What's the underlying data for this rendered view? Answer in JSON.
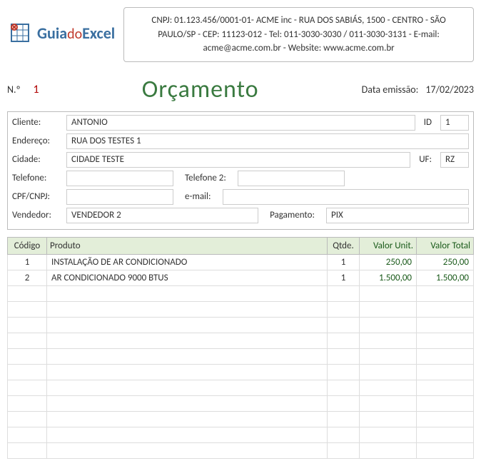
{
  "company_info": "CNPJ: 01.123.456/0001-01- ACME inc - RUA DOS SABIÁS, 1500 - CENTRO - SÃO PAULO/SP - CEP: 11123-012 - Tel: 011-3030-3030 / 011-3030-3131 - E-mail: acme@acme.com.br - Website: www.acme.com.br",
  "logo": {
    "guia": "Guia",
    "do": "do",
    "excel": "Excel"
  },
  "title": {
    "no_label": "N.º",
    "no_value": "1",
    "main": "Orçamento",
    "date_label": "Data emissão:",
    "date_value": "17/02/2023"
  },
  "customer": {
    "labels": {
      "cliente": "Cliente:",
      "id": "ID",
      "endereco": "Endereço:",
      "cidade": "Cidade:",
      "uf": "UF:",
      "telefone": "Telefone:",
      "telefone2": "Telefone 2:",
      "cpf": "CPF/CNPJ:",
      "email": "e-mail:",
      "vendedor": "Vendedor:",
      "pagamento": "Pagamento:"
    },
    "values": {
      "cliente": "ANTONIO",
      "id": "1",
      "endereco": "RUA DOS TESTES 1",
      "cidade": "CIDADE TESTE",
      "uf": "RZ",
      "telefone": "",
      "telefone2": "",
      "cpf": "",
      "email": "",
      "vendedor": "VENDEDOR 2",
      "pagamento": "PIX"
    }
  },
  "table": {
    "headers": {
      "codigo": "Código",
      "produto": "Produto",
      "qtde": "Qtde.",
      "unit": "Valor Unit.",
      "total": "Valor Total"
    },
    "rows": [
      {
        "codigo": "1",
        "produto": "INSTALAÇÃO DE AR CONDICIONADO",
        "qtde": "1",
        "unit": "250,00",
        "total": "250,00"
      },
      {
        "codigo": "2",
        "produto": "AR CONDICIONADO 9000 BTUS",
        "qtde": "1",
        "unit": "1.500,00",
        "total": "1.500,00"
      }
    ],
    "empty_rows": 11
  }
}
